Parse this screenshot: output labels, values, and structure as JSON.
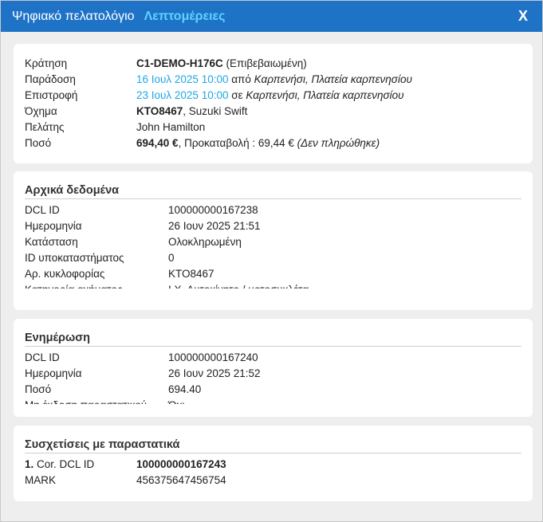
{
  "window": {
    "title": "Ψηφιακό πελατολόγιο",
    "subtitle": "Λεπτομέρειες",
    "close_label": "X"
  },
  "summary": {
    "booking_label": "Κράτηση",
    "booking_code": "C1-DEMO-H176C",
    "booking_status": "(Επιβεβαιωμένη)",
    "delivery_label": "Παράδοση",
    "delivery_datetime": "16 Ιουλ 2025 10:00",
    "delivery_from": "από",
    "delivery_place": "Καρπενήσι, Πλατεία καρπενησίου",
    "return_label": "Επιστροφή",
    "return_datetime": "23 Ιουλ 2025 10:00",
    "return_at": "σε",
    "return_place": "Καρπενήσι, Πλατεία καρπενησίου",
    "vehicle_label": "Όχημα",
    "vehicle_plate": "ΚΤΟ8467",
    "vehicle_model": ", Suzuki Swift",
    "customer_label": "Πελάτης",
    "customer_name": "John Hamilton",
    "amount_label": "Ποσό",
    "amount_value": "694,40 €",
    "amount_rest": ", Προκαταβολή : 69,44 €",
    "deposit_status": "(Δεν πληρώθηκε)"
  },
  "initial": {
    "title": "Αρχικά δεδομένα",
    "rows": [
      {
        "k": "DCL ID",
        "v": "100000000167238"
      },
      {
        "k": "Ημερομηνία",
        "v": "26 Ιουν 2025 21:51"
      },
      {
        "k": "Κατάσταση",
        "v": "Ολοκληρωμένη"
      },
      {
        "k": "ID υποκαταστήματος",
        "v": "0"
      },
      {
        "k": "Αρ. κυκλοφορίας",
        "v": "ΚΤΟ8467"
      },
      {
        "k": "Κατηγορία οχήματος",
        "v": "Ι.Χ. Αυτοκίνητο / μοτοσυκλέτα"
      }
    ]
  },
  "update": {
    "title": "Ενημέρωση",
    "rows": [
      {
        "k": "DCL ID",
        "v": "100000000167240"
      },
      {
        "k": "Ημερομηνία",
        "v": "26 Ιουν 2025 21:52"
      },
      {
        "k": "Ποσό",
        "v": "694.40"
      },
      {
        "k": "Μη έκδοση παραστατικού",
        "v": "Όχι"
      }
    ]
  },
  "relations": {
    "title": "Συσχετίσεις με παραστατικά",
    "index": "1.",
    "cor_label": "Cor. DCL ID",
    "cor_value": "100000000167243",
    "mark_label": "MARK",
    "mark_value": "456375647456754"
  }
}
